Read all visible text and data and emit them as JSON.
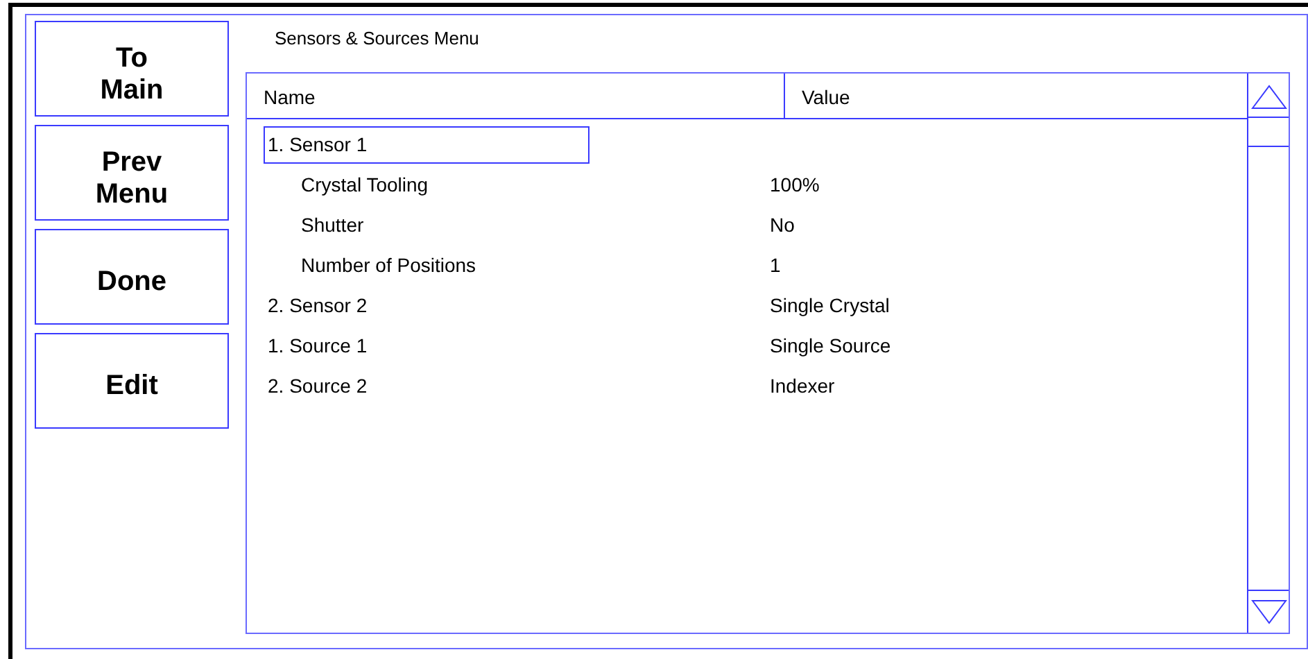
{
  "nav_buttons": [
    {
      "label": "To\nMain"
    },
    {
      "label": "Prev\nMenu"
    },
    {
      "label": "Done"
    },
    {
      "label": "Edit"
    }
  ],
  "title": "Sensors & Sources Menu",
  "table": {
    "columns": [
      "Name",
      "Value"
    ],
    "rows": [
      {
        "name": "1. Sensor 1",
        "selected": true,
        "children": [
          {
            "name": "Crystal Tooling",
            "value": "100%",
            "selected": false
          },
          {
            "name": "Shutter",
            "value": "No",
            "selected": false
          },
          {
            "name": "Number of Positions",
            "value": "1",
            "selected": false
          }
        ]
      },
      {
        "name": "2. Sensor 2",
        "value": "Single Crystal",
        "selected": false
      },
      {
        "name": "1. Source 1",
        "value": "Single Source",
        "selected": false
      },
      {
        "name": "2. Source 2",
        "value": "Indexer",
        "selected": false
      }
    ]
  }
}
